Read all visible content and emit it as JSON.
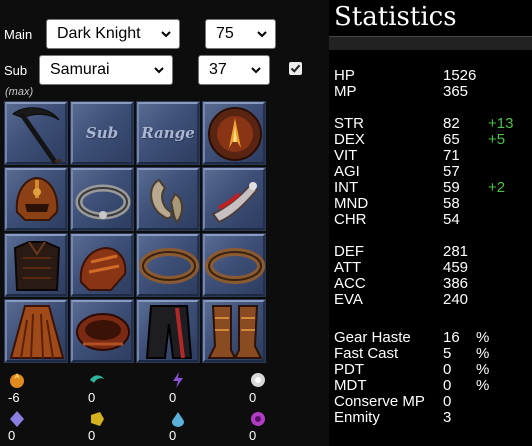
{
  "controls": {
    "main_label": "Main",
    "main_job": "Dark Knight",
    "main_level": "75",
    "sub_label": "Sub",
    "sub_job": "Samurai",
    "sub_level": "37",
    "max_checked": true,
    "max_label": "(max)"
  },
  "equipment": {
    "slots": [
      {
        "slot": "main",
        "icon": "scythe-icon"
      },
      {
        "slot": "sub",
        "label": "Sub"
      },
      {
        "slot": "range",
        "label": "Range"
      },
      {
        "slot": "ammo",
        "icon": "orb-ammo-icon"
      },
      {
        "slot": "head",
        "icon": "helm-icon"
      },
      {
        "slot": "neck",
        "icon": "torque-icon"
      },
      {
        "slot": "ear1",
        "icon": "earring-icon"
      },
      {
        "slot": "ear2",
        "icon": "earring-icon"
      },
      {
        "slot": "body",
        "icon": "armor-icon"
      },
      {
        "slot": "hands",
        "icon": "gauntlets-icon"
      },
      {
        "slot": "ring1",
        "icon": "ring-icon"
      },
      {
        "slot": "ring2",
        "icon": "ring-icon"
      },
      {
        "slot": "back",
        "icon": "cape-icon"
      },
      {
        "slot": "waist",
        "icon": "belt-icon"
      },
      {
        "slot": "legs",
        "icon": "legs-icon"
      },
      {
        "slot": "feet",
        "icon": "boots-icon"
      }
    ]
  },
  "elements": [
    {
      "name": "fire",
      "icon": "fire-crystal-icon",
      "value": "-6",
      "color": "#e08a20"
    },
    {
      "name": "wind",
      "icon": "wind-crystal-icon",
      "value": "0",
      "color": "#2fb59a"
    },
    {
      "name": "thunder",
      "icon": "thunder-crystal-icon",
      "value": "0",
      "color": "#8b4fd6"
    },
    {
      "name": "light",
      "icon": "light-crystal-icon",
      "value": "0",
      "color": "#d8d8d8"
    },
    {
      "name": "ice",
      "icon": "ice-crystal-icon",
      "value": "0",
      "color": "#8a7fe0"
    },
    {
      "name": "earth",
      "icon": "earth-crystal-icon",
      "value": "0",
      "color": "#d4b21e"
    },
    {
      "name": "water",
      "icon": "water-crystal-icon",
      "value": "0",
      "color": "#5ab0d8"
    },
    {
      "name": "dark",
      "icon": "dark-crystal-icon",
      "value": "0",
      "color": "#b23cc4"
    }
  ],
  "stats": {
    "title": "Statistics",
    "rows": [
      {
        "name": "HP",
        "value": "1526"
      },
      {
        "name": "MP",
        "value": "365"
      },
      {
        "name": "STR",
        "value": "82",
        "bonus": "+13"
      },
      {
        "name": "DEX",
        "value": "65",
        "bonus": "+5"
      },
      {
        "name": "VIT",
        "value": "71"
      },
      {
        "name": "AGI",
        "value": "57"
      },
      {
        "name": "INT",
        "value": "59",
        "bonus": "+2"
      },
      {
        "name": "MND",
        "value": "58"
      },
      {
        "name": "CHR",
        "value": "54"
      },
      {
        "name": "DEF",
        "value": "281"
      },
      {
        "name": "ATT",
        "value": "459"
      },
      {
        "name": "ACC",
        "value": "386"
      },
      {
        "name": "EVA",
        "value": "240"
      },
      {
        "name": "Gear Haste",
        "value": "16",
        "unit": "%"
      },
      {
        "name": "Fast Cast",
        "value": "5",
        "unit": "%"
      },
      {
        "name": "PDT",
        "value": "0",
        "unit": "%"
      },
      {
        "name": "MDT",
        "value": "0",
        "unit": "%"
      },
      {
        "name": "Conserve MP",
        "value": "0"
      },
      {
        "name": "Enmity",
        "value": "3"
      }
    ]
  },
  "colors": {
    "bonus_green": "#4cc04c",
    "slot_blue": "#3e5078"
  }
}
